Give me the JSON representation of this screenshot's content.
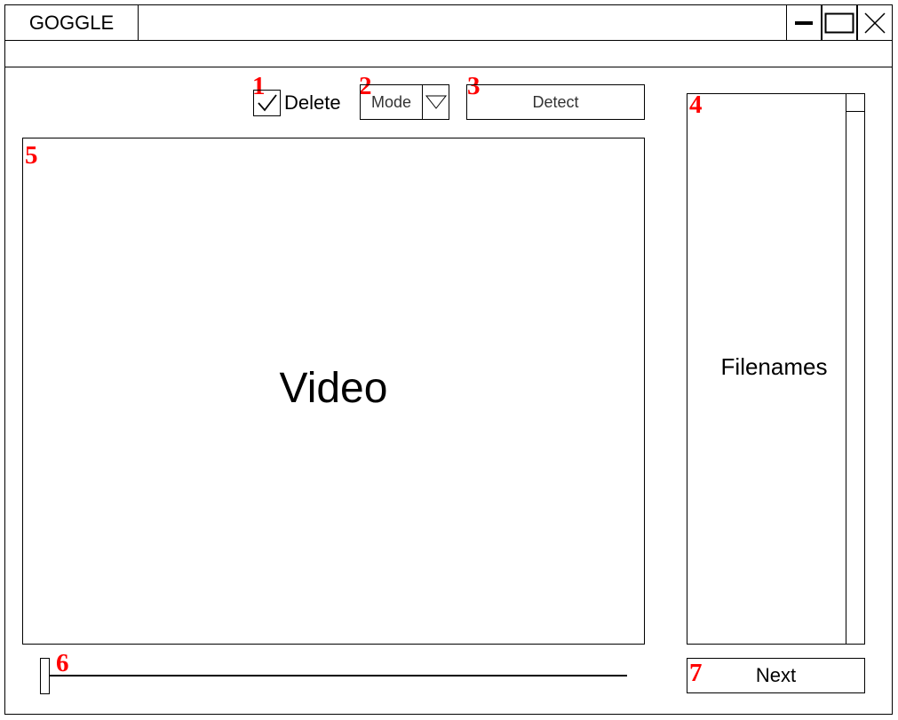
{
  "window": {
    "title": "GOGGLE",
    "controls": {
      "minimize_icon": "minimize-icon",
      "maximize_icon": "maximize-icon",
      "close_icon": "close-icon"
    }
  },
  "toolbar": {
    "delete_checkbox": {
      "label": "Delete",
      "checked": true,
      "number": "1"
    },
    "mode_select": {
      "selected": "Mode",
      "number": "2"
    },
    "detect_button": {
      "label": "Detect",
      "number": "3"
    }
  },
  "filenames": {
    "label": "Filenames",
    "number": "4"
  },
  "video": {
    "label": "Video",
    "number": "5"
  },
  "seek": {
    "number": "6",
    "value": 0
  },
  "next_button": {
    "label": "Next",
    "number": "7"
  },
  "colors": {
    "annotation": "#ff0000",
    "border": "#000000"
  }
}
